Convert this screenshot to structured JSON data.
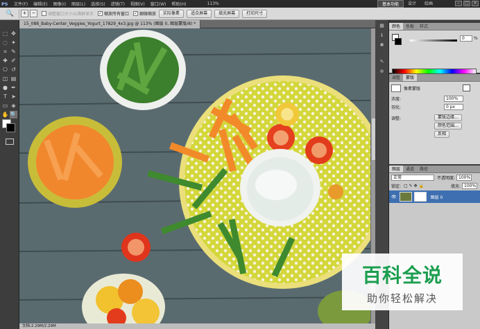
{
  "menubar": {
    "logo": "PS",
    "items": [
      "文件(F)",
      "编辑(E)",
      "图像(I)",
      "图层(L)",
      "选择(S)",
      "滤镜(T)",
      "视图(V)",
      "窗口(W)",
      "帮助(H)"
    ],
    "zoom": "113%",
    "workspaces": [
      "基本功能",
      "设计",
      "绘画"
    ],
    "window_controls": [
      "–",
      "□",
      "×"
    ]
  },
  "options": {
    "resize_window": "调整窗口大小以满屏显示",
    "zoom_all": "缩放所有窗口",
    "scrubby_zoom": "细微缩放",
    "actual_pixels": "实际像素",
    "fit_screen": "适合屏幕",
    "fill_screen": "填充屏幕",
    "print_size": "打印尺寸"
  },
  "document": {
    "tab_title": "15_088_Baby-Center_Veggies_Yogurt_17829_4x3.jpg @ 113% (图层 0, 图层蒙版/8) *",
    "status": "文档:2.29M/2.29M"
  },
  "panels": {
    "color_tabs": [
      "颜色",
      "色板",
      "样式"
    ],
    "color_value": "0",
    "color_unit": "%",
    "mask_tabs": [
      "调整",
      "蒙版"
    ],
    "mask_type": "像素蒙版",
    "density_label": "浓度:",
    "density_value": "100%",
    "feather_label": "羽化:",
    "feather_value": "0 px",
    "adjust_label": "调整:",
    "mask_edge": "蒙版边缘...",
    "color_range": "颜色范围...",
    "invert": "反相",
    "layers_tabs": [
      "图层",
      "通道",
      "路径"
    ],
    "blend_mode": "正常",
    "opacity_label": "不透明度:",
    "opacity_value": "100%",
    "lock_label": "锁定:",
    "fill_label": "填充:",
    "fill_value": "100%",
    "layer_name": "图层 0"
  },
  "watermark": {
    "title": "百科全说",
    "subtitle": "助你轻松解决"
  }
}
